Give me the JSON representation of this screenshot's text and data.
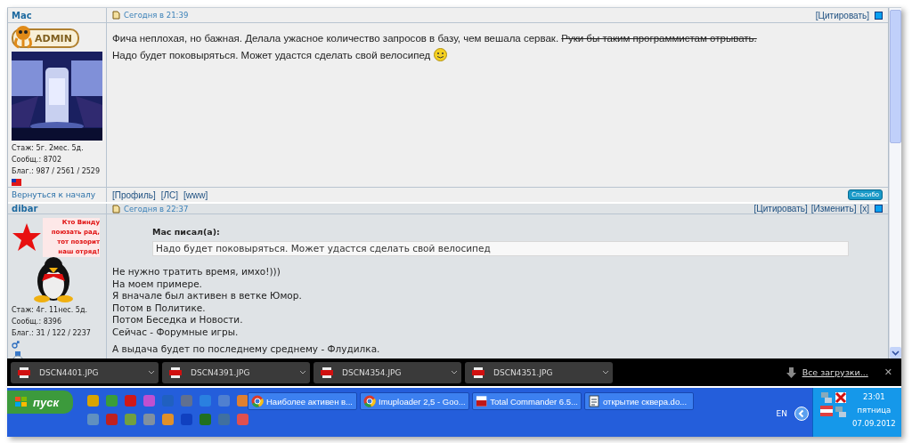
{
  "posts": [
    {
      "author": "Мас",
      "badge": {
        "kind": "admin",
        "label": "ADMIN"
      },
      "avatar": {
        "kind": "picture"
      },
      "stats": [
        "Стаж: 5г. 2мес. 5д.",
        "Сообщ.: 8702",
        "Благ.: 987 / 2561 / 2529"
      ],
      "marks": [
        {
          "kind": "flag"
        }
      ],
      "timestamp": "Сегодня в 21:39",
      "actions": [
        "[Цитировать]"
      ],
      "body": [
        {
          "segments": [
            {
              "text": "Фича неплохая, но бажная. Делала ужасное количество запросов в базу, чем вешала сервак. ",
              "strike": false
            },
            {
              "text": "Руки бы таким программистам отрывать.",
              "strike": true
            }
          ],
          "smiley": false
        },
        {
          "segments": [
            {
              "text": "Надо будет поковыряться. Может удастся сделать свой велосипед",
              "strike": false
            }
          ],
          "smiley": true
        }
      ],
      "back_link": "Вернуться к началу",
      "footer_links": [
        "[Профиль]",
        "[ЛС]",
        "[www]"
      ],
      "thanks": "Спасибо"
    },
    {
      "author": "dibar",
      "badge": {
        "kind": "slogan",
        "label": "Кто Винду поюзать рад, тот позорит наш отряд!"
      },
      "avatar": {
        "kind": "penguin"
      },
      "stats": [
        "Стаж: 4г. 11нес. 5д.",
        "Сообщ.: 8396",
        "Благ.: 31 / 122 / 2237"
      ],
      "marks": [
        {
          "kind": "male"
        },
        {
          "kind": "medal"
        }
      ],
      "timestamp": "Сегодня в 22:37",
      "actions": [
        "[Цитировать]",
        "[Изменить]",
        "[x]"
      ],
      "quote": {
        "author": "Мас писал(а):",
        "text": "Надо будет поковыряться. Может удастся сделать свой велосипед"
      },
      "lines": [
        "Не нужно тратить время, имхо!)))",
        "На моем примере.",
        "Я вначале был активен в ветке Юмор.",
        "Потом в Политике.",
        "Потом Беседка и Новости.",
        "Сейчас - Форумные игры."
      ],
      "after_break": [
        "А выдача будет по последнему среднему - Флудилка."
      ]
    }
  ],
  "downloads": {
    "items": [
      "DSCN4401.JPG",
      "DSCN4391.JPG",
      "DSCN4354.JPG",
      "DSCN4351.JPG"
    ],
    "all_link": "Все загрузки...",
    "close": "✕"
  },
  "taskbar": {
    "start": "пуск",
    "tasks": [
      {
        "label": "Наиболее активен в...",
        "kind": "browser"
      },
      {
        "label": "Imuploader 2,5 - Goo...",
        "kind": "browser"
      },
      {
        "label": "Total Commander 6.5...",
        "kind": "archive"
      },
      {
        "label": "открытие сквера.do...",
        "kind": "document"
      }
    ],
    "language": "EN",
    "time": "23:01",
    "weekday": "пятница",
    "date": "07.09.2012"
  }
}
